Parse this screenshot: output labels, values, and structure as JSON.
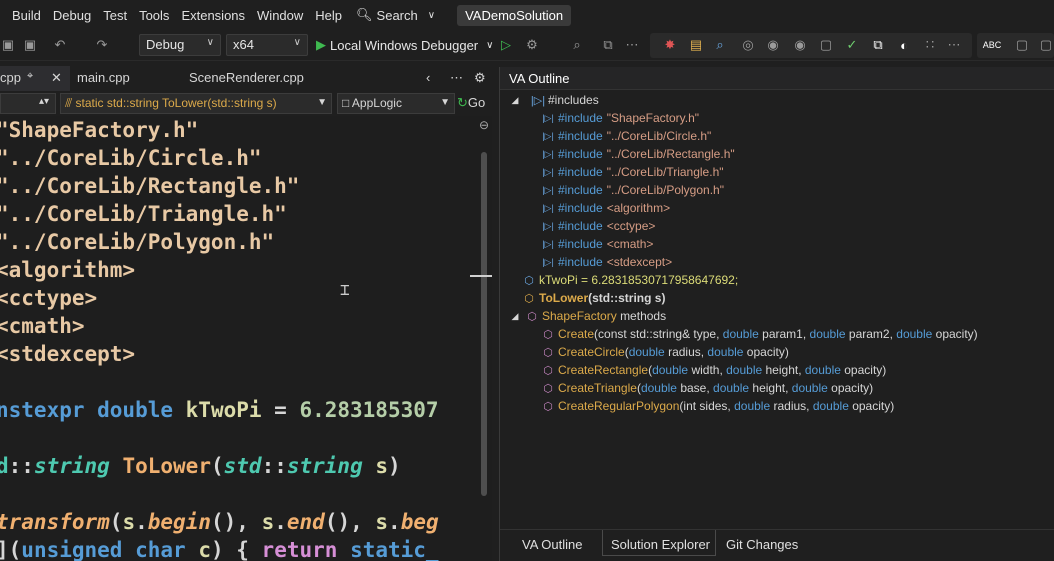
{
  "menu": [
    "Build",
    "Debug",
    "Test",
    "Tools",
    "Extensions",
    "Window",
    "Help"
  ],
  "search_label": "Search",
  "solution": "VADemoSolution",
  "toolbar": {
    "config": "Debug",
    "platform": "x64",
    "debugger": "Local Windows Debugger"
  },
  "tabs": [
    {
      "label": "cpp"
    },
    {
      "label": "main.cpp"
    },
    {
      "label": "SceneRenderer.cpp"
    }
  ],
  "nav": {
    "left": "",
    "middle": "static std::string ToLower(std::string s)",
    "right": "AppLogic",
    "go": "Go"
  },
  "code": [
    "\"ShapeFactory.h\"",
    "\"../CoreLib/Circle.h\"",
    "\"../CoreLib/Rectangle.h\"",
    "\"../CoreLib/Triangle.h\"",
    "\"../CoreLib/Polygon.h\"",
    "<algorithm>",
    "<cctype>",
    "<cmath>",
    "<stdexcept>"
  ],
  "outline": {
    "title": "VA Outline",
    "includes_label": "#includes",
    "includes": [
      {
        "kw": "#include",
        "val": "\"ShapeFactory.h\""
      },
      {
        "kw": "#include",
        "val": "\"../CoreLib/Circle.h\""
      },
      {
        "kw": "#include",
        "val": "\"../CoreLib/Rectangle.h\""
      },
      {
        "kw": "#include",
        "val": "\"../CoreLib/Triangle.h\""
      },
      {
        "kw": "#include",
        "val": "\"../CoreLib/Polygon.h\""
      },
      {
        "kw": "#include",
        "val": "<algorithm>"
      },
      {
        "kw": "#include",
        "val": "<cctype>"
      },
      {
        "kw": "#include",
        "val": "<cmath>"
      },
      {
        "kw": "#include",
        "val": "<stdexcept>"
      }
    ],
    "var": "kTwoPi = 6.28318530717958647692;",
    "tolower_name": "ToLower",
    "tolower_params": "(std::string s)",
    "methods_name": "ShapeFactory",
    "methods_label": "methods",
    "methods": [
      {
        "name": "Create",
        "params": [
          [
            "(const ",
            "typ"
          ],
          [
            "std::string",
            "typ"
          ],
          [
            "& type, ",
            "typ"
          ],
          [
            "double",
            "kw"
          ],
          [
            " param1, ",
            "typ"
          ],
          [
            "double",
            "kw"
          ],
          [
            " param2, ",
            "typ"
          ],
          [
            "double",
            "kw"
          ],
          [
            " opacity)",
            "typ"
          ]
        ]
      },
      {
        "name": "CreateCircle",
        "params": [
          [
            "(",
            "typ"
          ],
          [
            "double",
            "kw"
          ],
          [
            " radius, ",
            "typ"
          ],
          [
            "double",
            "kw"
          ],
          [
            " opacity)",
            "typ"
          ]
        ]
      },
      {
        "name": "CreateRectangle",
        "params": [
          [
            "(",
            "typ"
          ],
          [
            "double",
            "kw"
          ],
          [
            " width, ",
            "typ"
          ],
          [
            "double",
            "kw"
          ],
          [
            " height, ",
            "typ"
          ],
          [
            "double",
            "kw"
          ],
          [
            " opacity)",
            "typ"
          ]
        ]
      },
      {
        "name": "CreateTriangle",
        "params": [
          [
            "(",
            "typ"
          ],
          [
            "double",
            "kw"
          ],
          [
            " base, ",
            "typ"
          ],
          [
            "double",
            "kw"
          ],
          [
            " height, ",
            "typ"
          ],
          [
            "double",
            "kw"
          ],
          [
            " opacity)",
            "typ"
          ]
        ]
      },
      {
        "name": "CreateRegularPolygon",
        "params": [
          [
            "(int sides, ",
            "typ"
          ],
          [
            "double",
            "kw"
          ],
          [
            " radius, ",
            "typ"
          ],
          [
            "double",
            "kw"
          ],
          [
            " opacity)",
            "typ"
          ]
        ]
      }
    ],
    "bottom_tabs": [
      "VA Outline",
      "Solution Explorer",
      "Git Changes"
    ]
  }
}
